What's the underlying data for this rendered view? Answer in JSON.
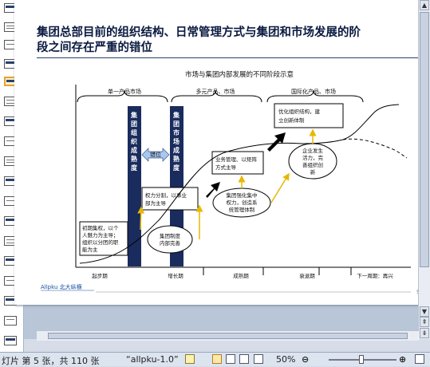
{
  "status_bar": {
    "slide_info": "灯片 第 5 张，共 110 张",
    "theme": "“allpku-1.0”",
    "zoom": "50%"
  },
  "slide": {
    "title_line1": "集团总部目前的组织结构、日常管理方式与集团和市场发展的阶",
    "title_line2": "段之间存在严重的错位",
    "diagram_title": "市场与集团内部发展的不同阶段示意",
    "market_stages": [
      "单一产品市场",
      "多元产品、市场",
      "国际化产品、市场"
    ],
    "vertical_bar1": [
      "集",
      "团",
      "组",
      "织",
      "成",
      "熟",
      "度"
    ],
    "vertical_bar2": [
      "集",
      "团",
      "市",
      "场",
      "成",
      "熟",
      "度"
    ],
    "gap_label": "错位",
    "box_centralized": [
      "初期集权，以个",
      "人魅力为主导；",
      "组织以分团的职",
      "能为主"
    ],
    "box_decentralize": [
      "权力分割，以事业",
      "部为主导"
    ],
    "box_business_sector": [
      "业务管理、以矩阵",
      "方式主导"
    ],
    "box_optimize": [
      "优化组织结构，建",
      "立创新体制"
    ],
    "ellipse_system": [
      "集团制度",
      "内部完善"
    ],
    "ellipse_control": [
      "集团强化集中",
      "权力，创造系",
      "统管理体制"
    ],
    "ellipse_vitality": [
      "企业发生",
      "活力，完",
      "善组织创",
      "新"
    ],
    "phases": [
      "起步期",
      "增长期",
      "成熟期",
      "衰退期",
      "下一周期：再兴"
    ],
    "logo_text": "Allpku 北大纵横",
    "page_num": "5"
  }
}
